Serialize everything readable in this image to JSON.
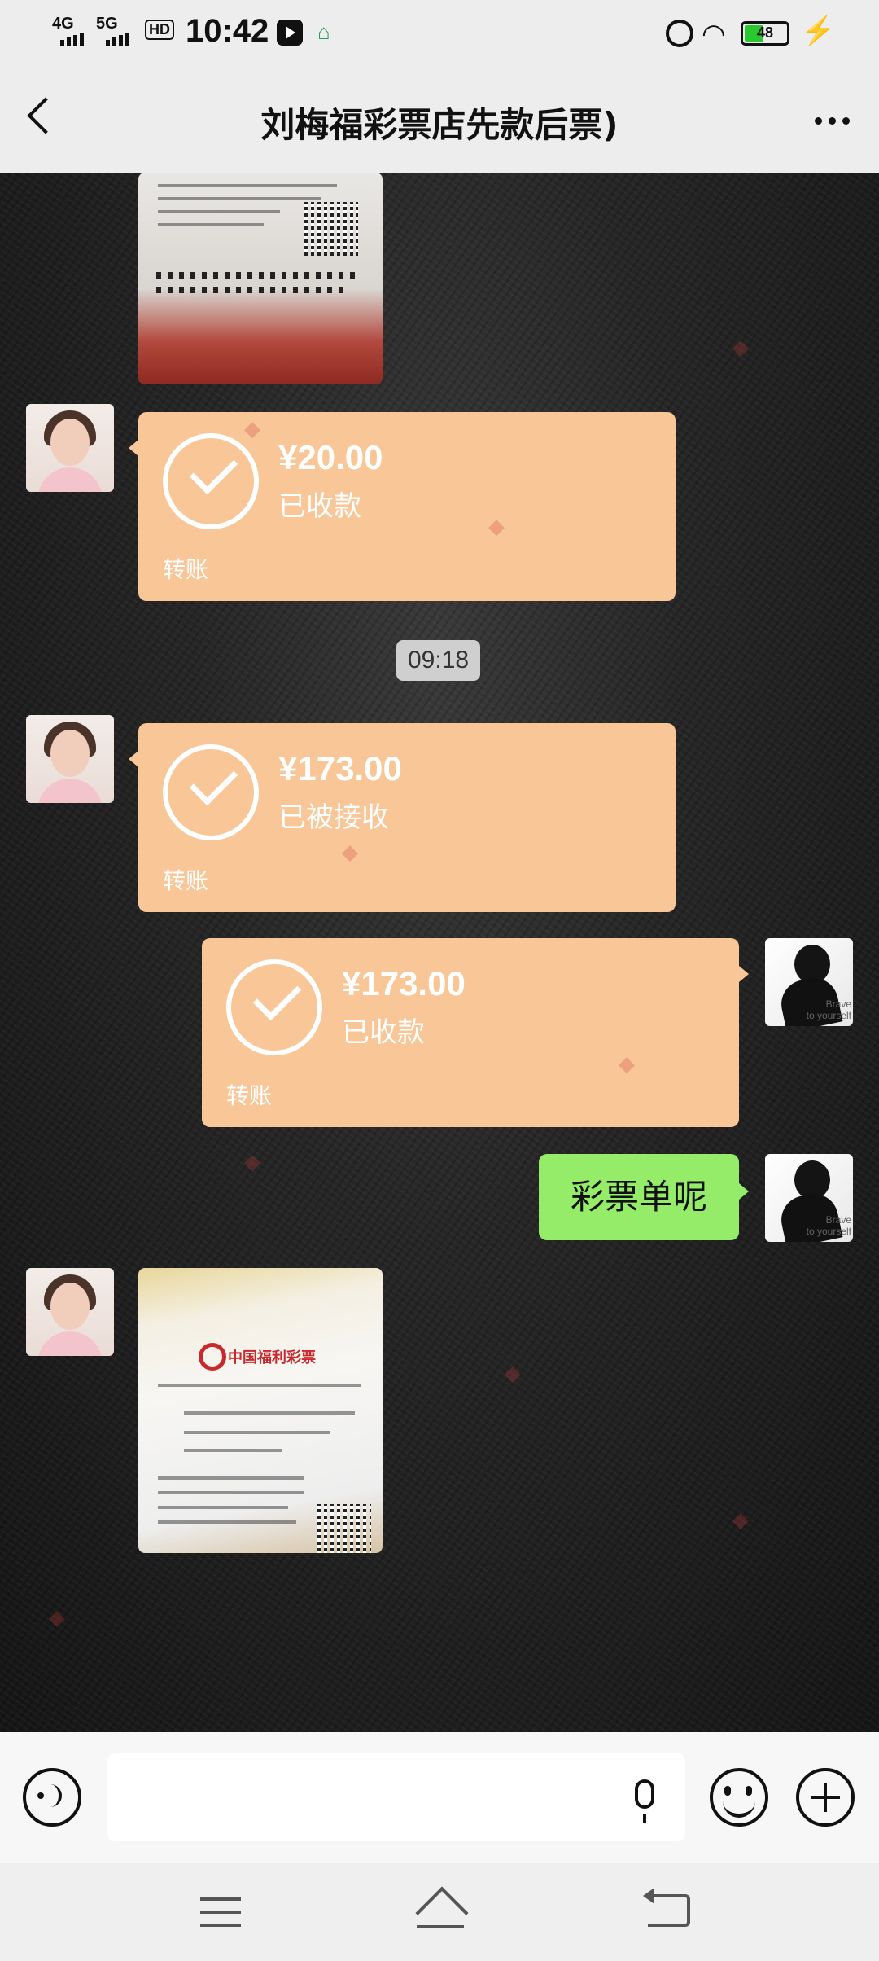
{
  "status_bar": {
    "network_1": "4G",
    "network_2": "5G",
    "hd": "HD",
    "time": "10:42",
    "battery": "48"
  },
  "header": {
    "title": "刘梅福彩票店先款后票)"
  },
  "messages": {
    "transfer_1": {
      "amount": "¥20.00",
      "status": "已收款",
      "label": "转账"
    },
    "timestamp": "09:18",
    "transfer_2": {
      "amount": "¥173.00",
      "status": "已被接收",
      "label": "转账"
    },
    "transfer_3": {
      "amount": "¥173.00",
      "status": "已收款",
      "label": "转账"
    },
    "text_1": "彩票单呢"
  },
  "avatars": {
    "self_caption": "Brave\nto yourself"
  },
  "ticket": {
    "brand": "中国福利彩票"
  },
  "input": {
    "placeholder": ""
  }
}
